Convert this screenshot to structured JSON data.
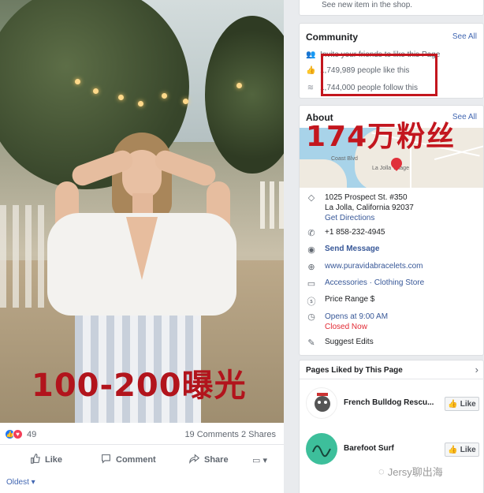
{
  "post": {
    "photo_caption": "100-200曝光",
    "reaction_count": "49",
    "comments_shares": "19 Comments  2 Shares",
    "actions": {
      "like": "Like",
      "comment": "Comment",
      "share": "Share"
    },
    "sort_label": "Oldest ▾"
  },
  "top_card": {
    "text": "See new item in the shop."
  },
  "community": {
    "title": "Community",
    "see_all": "See All",
    "rows": [
      {
        "icon": "people-icon",
        "text": "Invite your friends to like this Page"
      },
      {
        "icon": "thumbs-up-icon",
        "text": "1,749,989 people like this"
      },
      {
        "icon": "rss-icon",
        "text": "1,744,000 people follow this"
      }
    ]
  },
  "about": {
    "title": "About",
    "see_all": "See All",
    "overlay_caption": "174万粉丝",
    "map_labels": [
      "La Jolla Village",
      "Coast Blvd"
    ],
    "address_line1": "1025 Prospect St. #350",
    "address_line2": "La Jolla, California 92037",
    "directions": "Get Directions",
    "phone": "+1 858-232-4945",
    "message": "Send Message",
    "website": "www.puravidabracelets.com",
    "category": "Accessories · Clothing Store",
    "price": "Price Range $",
    "opens": "Opens at 9:00 AM",
    "closed": "Closed Now",
    "suggest": "Suggest Edits"
  },
  "liked": {
    "title": "Pages Liked by This Page",
    "items": [
      {
        "name": "French Bulldog Rescu...",
        "like": "Like"
      },
      {
        "name": "Barefoot Surf",
        "like": "Like"
      }
    ]
  },
  "watermark": "Jersy聊出海"
}
